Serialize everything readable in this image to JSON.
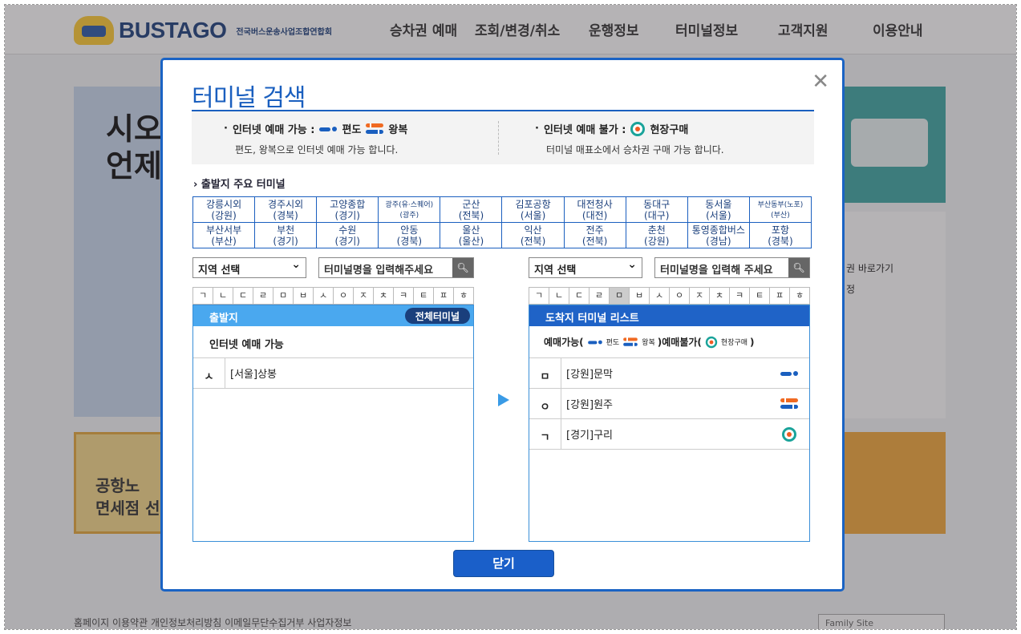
{
  "site": {
    "logo": "BUSTAGO",
    "logo_sub": "전국버스운송사업조합연합회",
    "nav": [
      "승차권 예매",
      "조회/변경/취소",
      "운행정보",
      "터미널정보",
      "고객지원",
      "이용안내"
    ],
    "banner_text": "시오\n언제",
    "promo_text": "공항노\n면세점 선",
    "side_link": "권 바로가기",
    "side_sub": "정",
    "footer_text": "홈페이지 이용약관  개인정보처리방침  이메일무단수집거부  사업자정보",
    "family_site": "Family Site"
  },
  "modal": {
    "title": "터미널 검색",
    "close_icon": "close-icon",
    "legend": {
      "online_label": "인터넷 예매 가능 :",
      "oneway": "편도",
      "round": "왕복",
      "online_desc": "편도, 왕복으로 인터넷 예매 가능 합니다.",
      "offline_label": "인터넷 예매 불가 :",
      "onsite": "현장구매",
      "offline_desc": "터미널 매표소에서 승차권 구매 가능 합니다."
    },
    "major_title": "출발지 주요 터미널",
    "major_terminals": [
      {
        "name": "강릉시외",
        "region": "(강원)"
      },
      {
        "name": "경주시외",
        "region": "(경북)"
      },
      {
        "name": "고양종합",
        "region": "(경기)"
      },
      {
        "name": "광주(유·스퀘어)",
        "region": "(광주)",
        "small": true
      },
      {
        "name": "군산",
        "region": "(전북)"
      },
      {
        "name": "김포공항",
        "region": "(서울)"
      },
      {
        "name": "대전청사",
        "region": "(대전)"
      },
      {
        "name": "동대구",
        "region": "(대구)"
      },
      {
        "name": "동서울",
        "region": "(서울)"
      },
      {
        "name": "부산동부(노포)",
        "region": "(부산)",
        "small": true
      },
      {
        "name": "부산서부",
        "region": "(부산)"
      },
      {
        "name": "부천",
        "region": "(경기)"
      },
      {
        "name": "수원",
        "region": "(경기)"
      },
      {
        "name": "안동",
        "region": "(경북)"
      },
      {
        "name": "울산",
        "region": "(울산)"
      },
      {
        "name": "익산",
        "region": "(전북)"
      },
      {
        "name": "전주",
        "region": "(전북)"
      },
      {
        "name": "춘천",
        "region": "(강원)"
      },
      {
        "name": "통영종합버스",
        "region": "(경남)"
      },
      {
        "name": "포항",
        "region": "(경북)"
      }
    ],
    "consonants": [
      "ㄱ",
      "ㄴ",
      "ㄷ",
      "ㄹ",
      "ㅁ",
      "ㅂ",
      "ㅅ",
      "ㅇ",
      "ㅈ",
      "ㅊ",
      "ㅋ",
      "ㅌ",
      "ㅍ",
      "ㅎ"
    ],
    "departure": {
      "region_select": "지역 선택",
      "search_placeholder": "터미널명을 입력해주세요",
      "header": "출발지",
      "all_button": "전체터미널",
      "subheader": "인터넷 예매 가능",
      "rows": [
        {
          "initial": "ㅅ",
          "name": "[서울]상봉"
        }
      ]
    },
    "arrival": {
      "region_select": "지역 선택",
      "search_placeholder": "터미널명을 입력해 주세요",
      "header": "도착지 터미널 리스트",
      "selected_consonant": "ㅁ",
      "legend_prefix": "예매가능(",
      "legend_oneway": "편도",
      "legend_round": "왕복",
      "legend_mid": ")예매불가(",
      "legend_onsite": "현장구매",
      "legend_suffix": ")",
      "rows": [
        {
          "initial": "ㅁ",
          "name": "[강원]문막",
          "icon": "oneway-icon"
        },
        {
          "initial": "ㅇ",
          "name": "[강원]원주",
          "icon": "round-trip-icon"
        },
        {
          "initial": "ㄱ",
          "name": "[경기]구리",
          "icon": "onsite-icon"
        }
      ]
    },
    "close_button": "닫기"
  }
}
